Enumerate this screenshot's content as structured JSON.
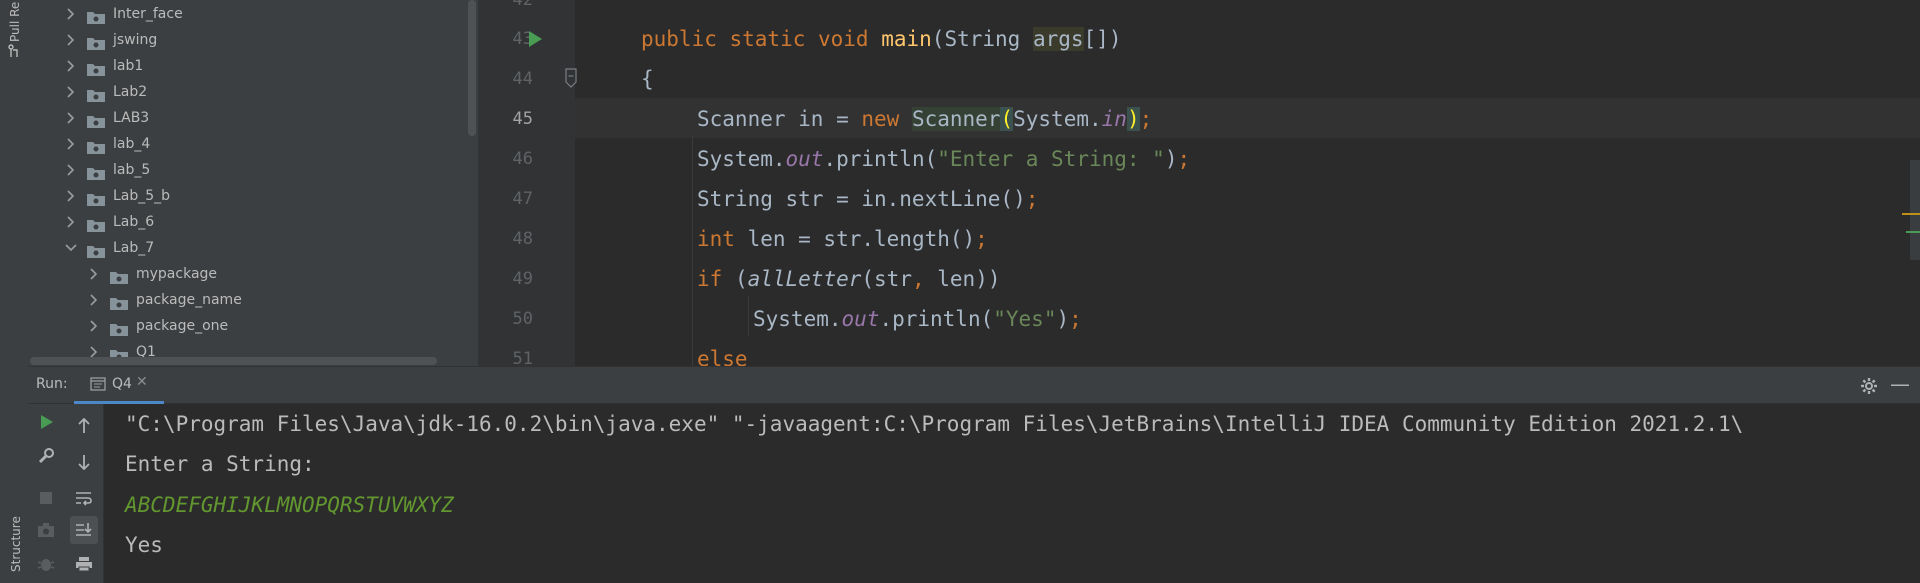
{
  "sidebar_strip": {
    "top_tab": "Pull Re",
    "bottom_tab": "Structure"
  },
  "project_tree": {
    "items": [
      {
        "label": "Inter_face",
        "expanded": false,
        "level": 1
      },
      {
        "label": "jswing",
        "expanded": false,
        "level": 1
      },
      {
        "label": "lab1",
        "expanded": false,
        "level": 1
      },
      {
        "label": "Lab2",
        "expanded": false,
        "level": 1
      },
      {
        "label": "LAB3",
        "expanded": false,
        "level": 1
      },
      {
        "label": "lab_4",
        "expanded": false,
        "level": 1
      },
      {
        "label": "lab_5",
        "expanded": false,
        "level": 1
      },
      {
        "label": "Lab_5_b",
        "expanded": false,
        "level": 1
      },
      {
        "label": "Lab_6",
        "expanded": false,
        "level": 1
      },
      {
        "label": "Lab_7",
        "expanded": true,
        "level": 1
      },
      {
        "label": "mypackage",
        "expanded": false,
        "level": 2
      },
      {
        "label": "package_name",
        "expanded": false,
        "level": 2
      },
      {
        "label": "package_one",
        "expanded": false,
        "level": 2
      },
      {
        "label": "Q1",
        "expanded": false,
        "level": 2
      }
    ]
  },
  "editor": {
    "current_line": "45",
    "line_numbers": [
      "42",
      "43",
      "44",
      "45",
      "46",
      "47",
      "48",
      "49",
      "50",
      "51"
    ]
  },
  "run_panel": {
    "label": "Run:",
    "tab_name": "Q4",
    "console": {
      "command": "\"C:\\Program Files\\Java\\jdk-16.0.2\\bin\\java.exe\" \"-javaagent:C:\\Program Files\\JetBrains\\IntelliJ IDEA Community Edition 2021.2.1\\",
      "prompt": "Enter a String:",
      "input": "ABCDEFGHIJKLMNOPQRSTUVWXYZ",
      "output": "Yes"
    }
  },
  "colors": {
    "keyword": "#cc7832",
    "method": "#ffc66d",
    "string": "#6a8759",
    "field": "#9876aa",
    "run_green": "#499c54",
    "console_input": "#62972f"
  }
}
